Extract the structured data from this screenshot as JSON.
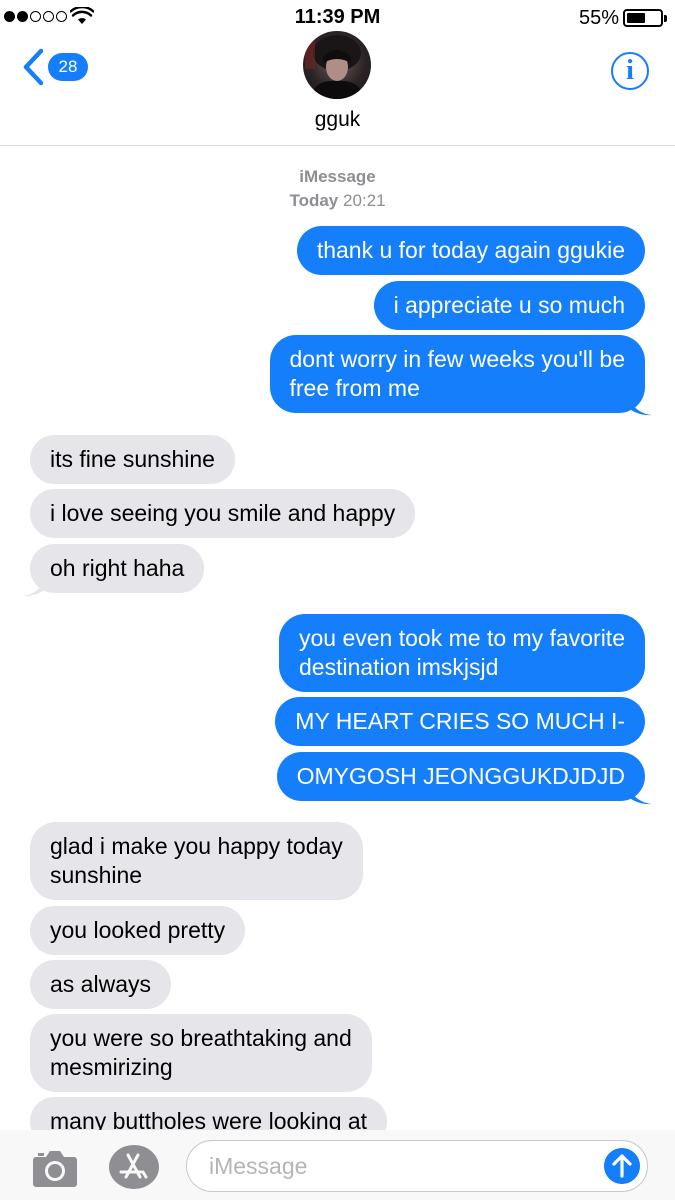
{
  "status_bar": {
    "time": "11:39 PM",
    "battery_percent": "55%",
    "battery_level": 0.55,
    "signal_bars_on": 2,
    "signal_bars_total": 5
  },
  "header": {
    "back_badge": "28",
    "contact_name": "gguk",
    "info_label": "i"
  },
  "thread": {
    "service": "iMessage",
    "date_day": "Today",
    "date_time": "20:21"
  },
  "messages": [
    {
      "text": "thank u for today again ggukie"
    },
    {
      "text": "i appreciate u so much"
    },
    {
      "text": "dont worry in few weeks you'll be\nfree from me"
    },
    {
      "text": "its fine sunshine"
    },
    {
      "text": "i love seeing you smile and happy"
    },
    {
      "text": "oh right haha"
    },
    {
      "text": "you even took me to my favorite\ndestination imskjsjd"
    },
    {
      "text": "MY HEART CRIES SO MUCH I-"
    },
    {
      "text": "OMYGOSH JEONGGUKDJDJD"
    },
    {
      "text": "glad i make you happy today\nsunshine"
    },
    {
      "text": "you looked pretty"
    },
    {
      "text": "as always"
    },
    {
      "text": "you were so breathtaking and\nmesmirizing"
    },
    {
      "text": "many buttholes were looking at"
    }
  ],
  "composer": {
    "placeholder": "iMessage"
  },
  "colors": {
    "sent_bubble": "#147efb",
    "received_bubble": "#e5e5ea",
    "accent": "#147efb",
    "secondary_text": "#8e8e93"
  }
}
